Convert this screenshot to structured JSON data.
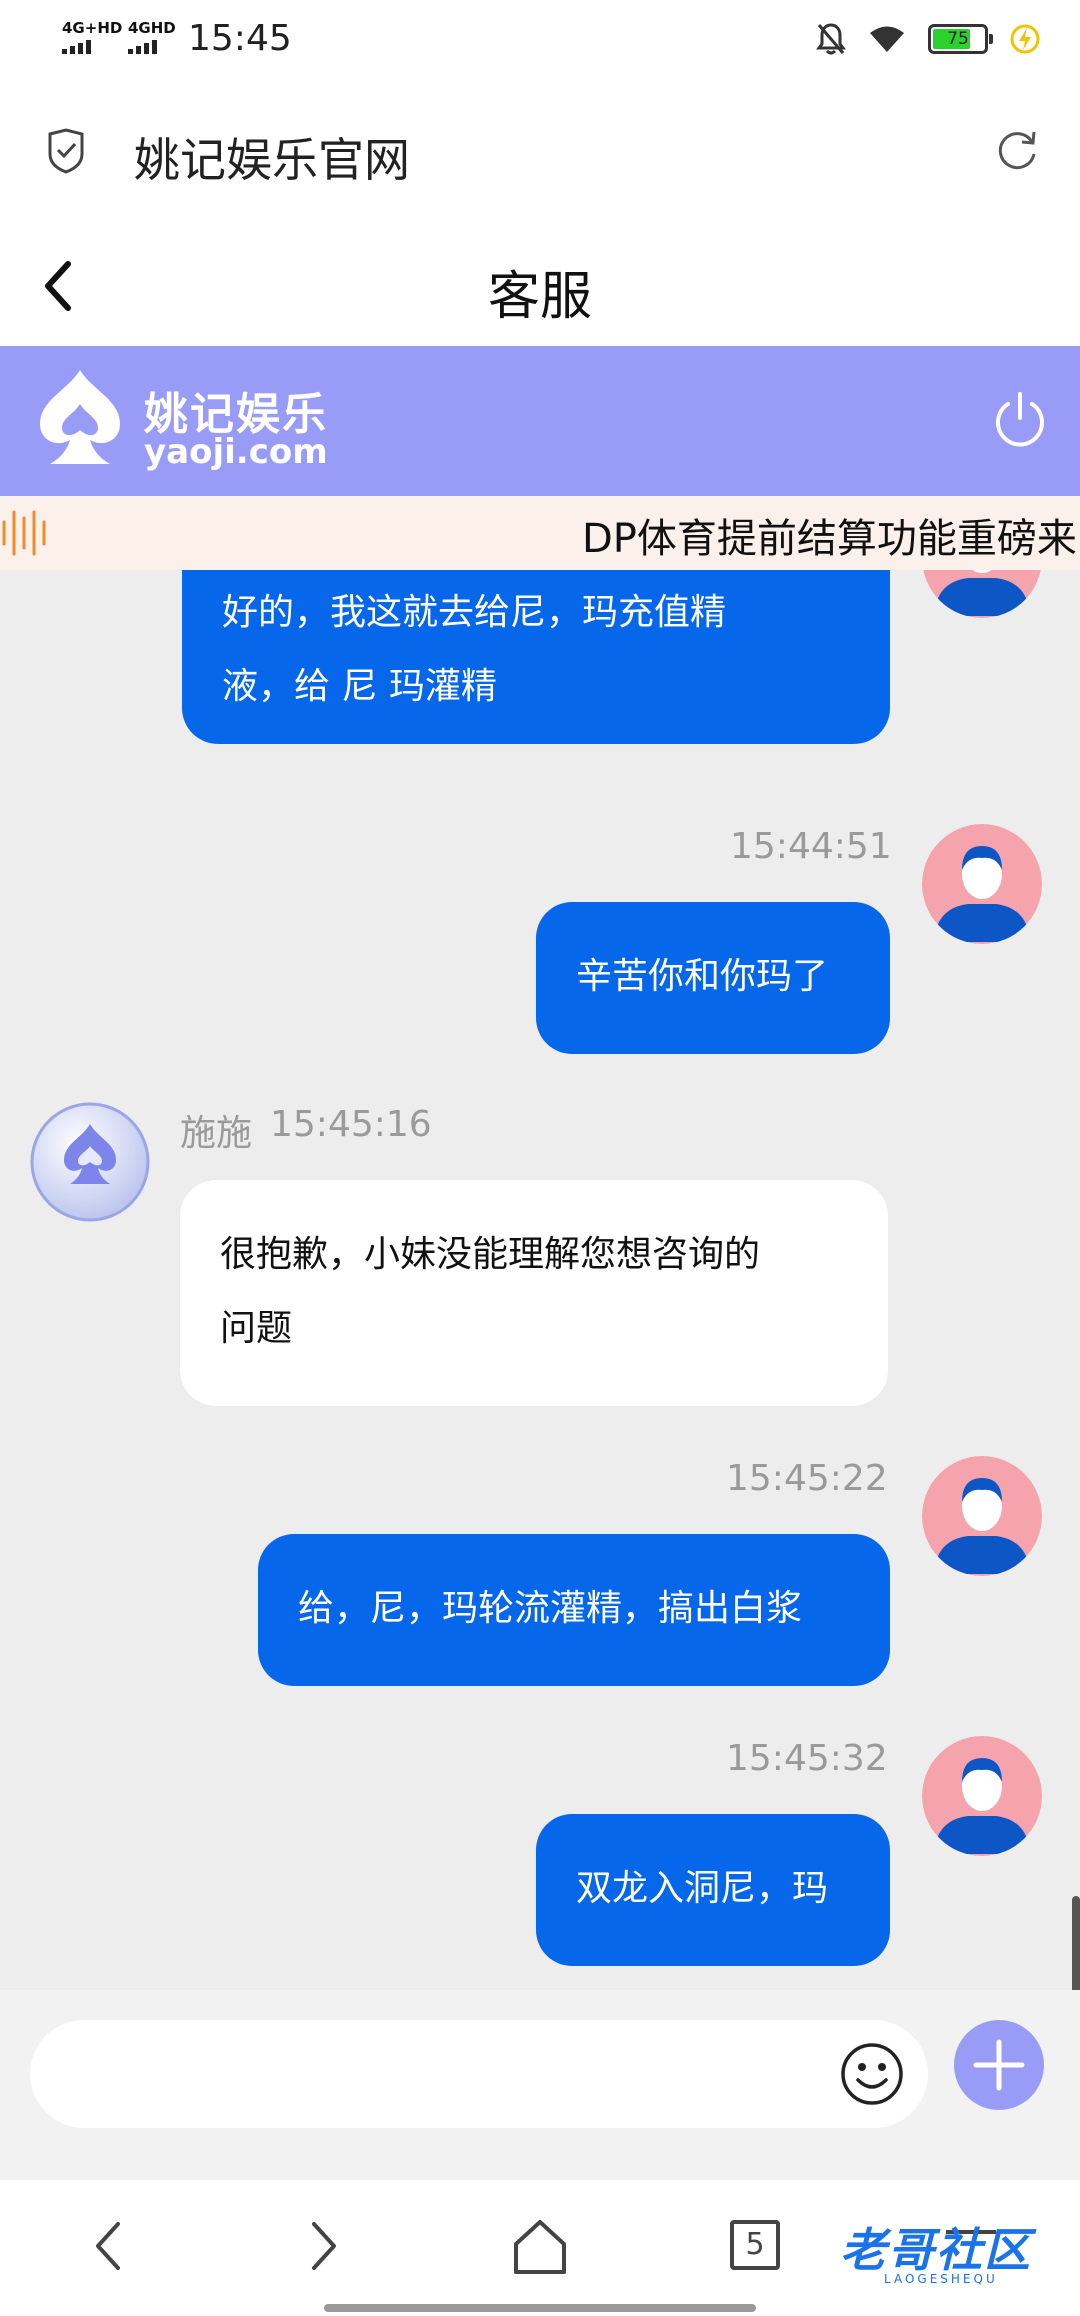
{
  "status_bar": {
    "network_1": "4G+HD",
    "network_2": "4GHD",
    "time": "15:45",
    "battery_level": "75",
    "battery_color": "#2cd22c",
    "icons": [
      "mute-bell-icon",
      "wifi-icon",
      "battery-icon",
      "charging-bolt-icon"
    ]
  },
  "browser": {
    "site_title": "姚记娱乐官网",
    "icons": [
      "shield-check-icon",
      "reload-icon"
    ]
  },
  "header": {
    "title": "客服",
    "back_icon": "chevron-left-icon"
  },
  "brand": {
    "name": "姚记娱乐",
    "domain": "yaoji.com",
    "accent_color": "#999cf6",
    "icons": [
      "spade-logo-icon",
      "power-icon"
    ]
  },
  "notice": {
    "text": "DP体育提前结算功能重磅来",
    "icon": "sound-wave-icon"
  },
  "messages": [
    {
      "side": "out",
      "text_line1": "好的，我这就去给尼，玛充值精",
      "text_line2": "液，给 尼 玛灌精"
    },
    {
      "side": "out",
      "time": "15:44:51",
      "text": "辛苦你和你玛了"
    },
    {
      "side": "in",
      "sender": "施施",
      "time": "15:45:16",
      "text_line1": "很抱歉，小妹没能理解您想咨询的",
      "text_line2": "问题"
    },
    {
      "side": "out",
      "time": "15:45:22",
      "text": "给，尼，玛轮流灌精，搞出白浆"
    },
    {
      "side": "out",
      "time": "15:45:32",
      "text": "双龙入洞尼，玛"
    }
  ],
  "bubble_color_out": "#0667ea",
  "input": {
    "placeholder": "",
    "icons": [
      "emoji-icon",
      "plus-icon"
    ]
  },
  "bottom_nav": {
    "tab_count": "5",
    "watermark": "老哥社区",
    "watermark_sub": "LAOGESHEQU",
    "icons": [
      "back-arrow-icon",
      "forward-arrow-icon",
      "home-icon",
      "tabs-icon",
      "menu-icon"
    ]
  }
}
